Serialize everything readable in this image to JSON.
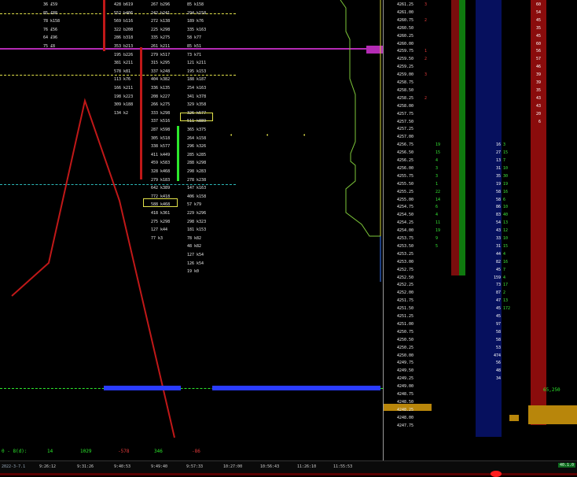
{
  "footprint": {
    "rows": [
      {
        "l": "36 £59",
        "m": "428 b619",
        "r": "267 b296",
        "r2": "85 k158"
      },
      {
        "l": "85 £88",
        "m": "552 b406",
        "r": "242 b241",
        "r2": "294 k158"
      },
      {
        "l": "78 k158",
        "m": "569 b116",
        "r": "272 k138",
        "r2": "189 k76"
      },
      {
        "l": "76 £56",
        "m": "322 b208",
        "r": "225 k298",
        "r2": "335 k163"
      },
      {
        "l": "64 £96",
        "m": "286 b318",
        "r": "335 k275",
        "r2": "58 k77"
      },
      {
        "l": "75 £8",
        "m": "353 b213",
        "r": "261 k211",
        "r2": "85 k51"
      },
      {
        "l": "",
        "m": "195 b226",
        "r": "279 k517",
        "r2": "73 k71"
      },
      {
        "l": "",
        "m": "381 k211",
        "r": "315 k295",
        "r2": "121 k211"
      },
      {
        "l": "",
        "m": "578 k81",
        "r": "337 k248",
        "r2": "195 k153"
      },
      {
        "l": "",
        "m": "113 k76",
        "r": "404 k382",
        "r2": "188 k187"
      },
      {
        "l": "",
        "m": "166 k211",
        "r": "336 k135",
        "r2": "254 k163"
      },
      {
        "l": "",
        "m": "198 k223",
        "r": "208 k227",
        "r2": "341 k378"
      },
      {
        "l": "",
        "m": "309 k188",
        "r": "266 k275",
        "r2": "329 k358"
      },
      {
        "l": "",
        "m": "134 k2",
        "r": "333 k298",
        "r2": "326 k577"
      },
      {
        "l": "",
        "m": "",
        "r": "337 k516",
        "r2": "511 k889"
      },
      {
        "l": "",
        "m": "",
        "r": "287 k598",
        "r2": "365 k375"
      },
      {
        "l": "",
        "m": "",
        "r": "305 k518",
        "r2": "264 k158"
      },
      {
        "l": "",
        "m": "",
        "r": "338 k577",
        "r2": "296 k326"
      },
      {
        "l": "",
        "m": "",
        "r": "411 k449",
        "r2": "285 k285"
      },
      {
        "l": "",
        "m": "",
        "r": "459 k583",
        "r2": "288 k298"
      },
      {
        "l": "",
        "m": "",
        "r": "328 k468",
        "r2": "298 k283"
      },
      {
        "l": "",
        "m": "",
        "r": "279 k183",
        "r2": "278 k238"
      },
      {
        "l": "",
        "m": "",
        "r": "642 k389",
        "r2": "147 k163"
      },
      {
        "l": "",
        "m": "",
        "r": "772 k418",
        "r2": "406 k158"
      },
      {
        "l": "",
        "m": "",
        "r": "588 k468",
        "r2": "57 k79"
      },
      {
        "l": "",
        "m": "",
        "r": "418 k361",
        "r2": "229 k296"
      },
      {
        "l": "",
        "m": "",
        "r": "275 k298",
        "r2": "298 k323"
      },
      {
        "l": "",
        "m": "",
        "r": "127 k44",
        "r2": "181 k153"
      },
      {
        "l": "",
        "m": "",
        "r": "77 k3",
        "r2": "78 k82"
      },
      {
        "l": "",
        "m": "",
        "r": "",
        "r2": "48 k82"
      },
      {
        "l": "",
        "m": "",
        "r": "",
        "r2": "127 k54"
      },
      {
        "l": "",
        "m": "",
        "r": "",
        "r2": "126 k54"
      },
      {
        "l": "",
        "m": "",
        "r": "",
        "r2": "19 k0"
      }
    ]
  },
  "bottom_stats": {
    "label": "0 - 8(d):",
    "values": [
      "14",
      "1029",
      "-578",
      "346",
      "-86"
    ]
  },
  "time_axis": [
    "9:26:12",
    "9:31:26",
    "9:40:53",
    "9:49:40",
    "9:57:33",
    "10:27:00",
    "10:56:43",
    "11:26:10",
    "11:55:53"
  ],
  "date_label": "2022-3-7.1",
  "ladder": {
    "prices": [
      "4261.25",
      "4261.00",
      "4260.75",
      "4260.50",
      "4260.25",
      "4260.00",
      "4259.75",
      "4259.50",
      "4259.25",
      "4259.00",
      "4258.75",
      "4258.50",
      "4258.25",
      "4258.00",
      "4257.75",
      "4257.50",
      "4257.25",
      "4257.00",
      "4256.75",
      "4256.50",
      "4256.25",
      "4256.00",
      "4255.75",
      "4255.50",
      "4255.25",
      "4255.00",
      "4254.75",
      "4254.50",
      "4254.25",
      "4254.00",
      "4253.75",
      "4253.50",
      "4253.25",
      "4253.00",
      "4252.75",
      "4252.50",
      "4252.25",
      "4252.00",
      "4251.75",
      "4251.50",
      "4251.25",
      "4251.00",
      "4250.75",
      "4250.50",
      "4250.25",
      "4250.00",
      "4249.75",
      "4249.50",
      "4249.25",
      "4249.00",
      "4248.75",
      "4248.50",
      "4248.25",
      "4248.00",
      "4247.75"
    ],
    "bid_red": [
      "3",
      "",
      "2",
      "",
      "",
      "",
      "1",
      "2",
      "",
      "3",
      "",
      "",
      "2",
      "",
      "",
      "",
      "",
      "",
      "",
      "",
      "",
      "",
      "",
      "",
      "",
      "",
      "",
      "",
      "",
      "",
      "",
      "",
      "",
      "",
      "",
      "",
      "",
      "",
      "",
      "",
      "",
      "",
      "",
      "",
      "",
      "",
      "",
      "",
      "",
      "",
      "",
      "",
      "",
      "",
      ""
    ],
    "left_green": [
      "",
      "",
      "",
      "",
      "",
      "",
      "",
      "",
      "",
      "",
      "",
      "",
      "",
      "",
      "",
      "",
      "",
      "",
      "19",
      "15",
      "4",
      "3",
      "3",
      "1",
      "22",
      "14",
      "6",
      "4",
      "11",
      "19",
      "9",
      "5",
      "",
      "",
      "",
      "",
      "",
      "",
      "",
      "",
      "",
      "",
      "",
      "",
      "",
      "",
      "",
      "",
      "",
      "",
      "",
      "",
      "",
      "",
      ""
    ],
    "volume": [
      "",
      "",
      "",
      "",
      "",
      "",
      "",
      "",
      "",
      "",
      "",
      "",
      "",
      "",
      "",
      "",
      "",
      "",
      "16",
      "27",
      "13",
      "31",
      "35",
      "19",
      "58",
      "58",
      "86",
      "83",
      "54",
      "43",
      "33",
      "31",
      "44",
      "82",
      "45",
      "159",
      "73",
      "87",
      "47",
      "45",
      "45",
      "97",
      "58",
      "58",
      "53",
      "474",
      "56",
      "48",
      "34",
      "",
      "",
      "",
      "",
      "",
      ""
    ],
    "ask_green": [
      "",
      "",
      "",
      "",
      "",
      "",
      "",
      "",
      "",
      "",
      "",
      "",
      "",
      "",
      "",
      "",
      "",
      "",
      "3",
      "15",
      "7",
      "10",
      "30",
      "19",
      "16",
      "6",
      "10",
      "40",
      "13",
      "12",
      "10",
      "15",
      "4",
      "16",
      "7",
      "4",
      "17",
      "2",
      "13",
      "172",
      "",
      "",
      "",
      "",
      "",
      "",
      "",
      "",
      "",
      "",
      "",
      "",
      "",
      "",
      ""
    ],
    "right": [
      "60",
      "54",
      "45",
      "35",
      "45",
      "60",
      "56",
      "57",
      "46",
      "39",
      "39",
      "35",
      "43",
      "43",
      "20",
      "6",
      "",
      "",
      "",
      "",
      "",
      "",
      "",
      "",
      "",
      "",
      "",
      "",
      "",
      "",
      "",
      "",
      "",
      "",
      "",
      "",
      "",
      "",
      "",
      "",
      "",
      "",
      "",
      "",
      "",
      "",
      "",
      "",
      "",
      "",
      "",
      "",
      "",
      "",
      ""
    ],
    "right_label": "65,250"
  },
  "status_indicator": "40.1.0",
  "colors": {
    "magenta": "#b42bb4",
    "yellow": "#e2e24a",
    "cyan": "#2bb8b8",
    "blue": "#2a3cff",
    "red": "#c01818",
    "green": "#2ce82c",
    "gold": "#c98a00"
  }
}
